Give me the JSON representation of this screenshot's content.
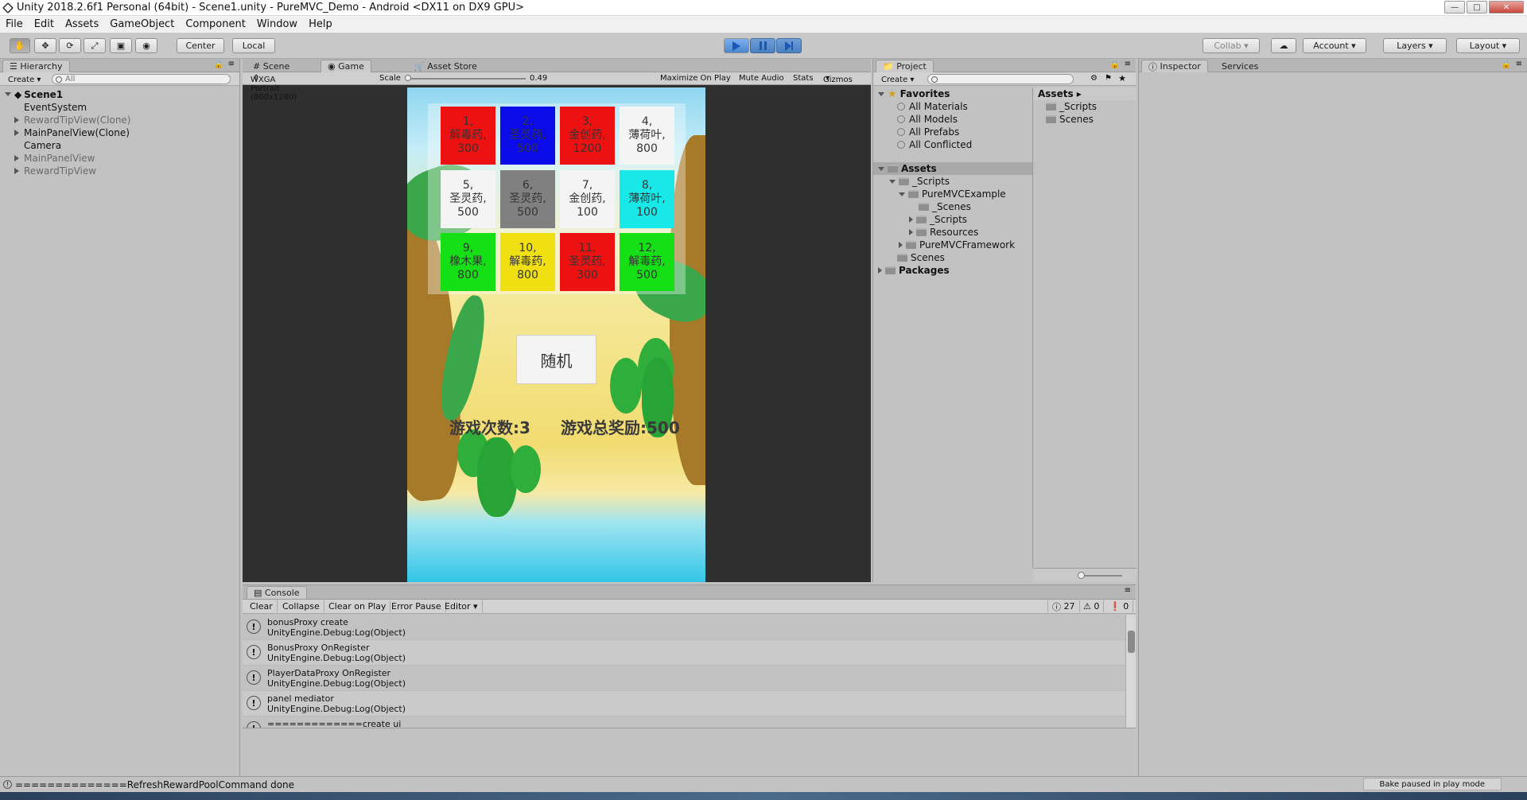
{
  "window": {
    "title": "Unity 2018.2.6f1 Personal (64bit) - Scene1.unity - PureMVC_Demo - Android <DX11 on DX9 GPU>"
  },
  "menu": [
    "File",
    "Edit",
    "Assets",
    "GameObject",
    "Component",
    "Window",
    "Help"
  ],
  "toolbar": {
    "pivot": "Center",
    "space": "Local",
    "collab": "Collab",
    "account": "Account",
    "layers": "Layers",
    "layout": "Layout"
  },
  "hierarchy": {
    "tab": "Hierarchy",
    "create": "Create",
    "search_placeholder": "All",
    "scene": "Scene1",
    "items": [
      {
        "label": "EventSystem",
        "prefab": false,
        "foldable": false
      },
      {
        "label": "RewardTipView(Clone)",
        "prefab": true,
        "foldable": true
      },
      {
        "label": "MainPanelView(Clone)",
        "prefab": false,
        "foldable": true
      },
      {
        "label": "Camera",
        "prefab": false,
        "foldable": false
      },
      {
        "label": "MainPanelView",
        "prefab": true,
        "foldable": true
      },
      {
        "label": "RewardTipView",
        "prefab": true,
        "foldable": true
      }
    ]
  },
  "gameview": {
    "tabs": [
      "Scene",
      "Game",
      "Asset Store"
    ],
    "resolution": "WXGA Portrait (800x1280)",
    "scale_label": "Scale",
    "scale_value": "0.49",
    "toggles": [
      "Maximize On Play",
      "Mute Audio",
      "Stats",
      "Gizmos"
    ]
  },
  "game": {
    "cells": [
      {
        "text": "1,\n解毒药,\n300",
        "color": "#ee1111"
      },
      {
        "text": "2,\n圣灵药,\n500",
        "color": "#0b0bea"
      },
      {
        "text": "3,\n金创药,\n1200",
        "color": "#ee1111"
      },
      {
        "text": "4,\n薄荷叶,\n800",
        "color": "#f4f4f4"
      },
      {
        "text": "5,\n圣灵药,\n500",
        "color": "#f4f4f4"
      },
      {
        "text": "6,\n圣灵药,\n500",
        "color": "#808080"
      },
      {
        "text": "7,\n金创药,\n100",
        "color": "#f4f4f4"
      },
      {
        "text": "8,\n薄荷叶,\n100",
        "color": "#18e8e8"
      },
      {
        "text": "9,\n橡木果,\n800",
        "color": "#15e015"
      },
      {
        "text": "10,\n解毒药,\n800",
        "color": "#f0e012"
      },
      {
        "text": "11,\n圣灵药,\n300",
        "color": "#ee1111"
      },
      {
        "text": "12,\n解毒药,\n500",
        "color": "#15e015"
      }
    ],
    "random_button": "随机",
    "play_count": "游戏次数:3",
    "total_reward": "游戏总奖励:500"
  },
  "project": {
    "tab": "Project",
    "create": "Create",
    "favorites": "Favorites",
    "fav_items": [
      "All Materials",
      "All Models",
      "All Prefabs",
      "All Conflicted"
    ],
    "assets": "Assets",
    "tree": [
      "_Scripts",
      "PureMVCExample",
      "_Scenes",
      "_Scripts",
      "Resources",
      "PureMVCFramework",
      "Scenes"
    ],
    "packages": "Packages",
    "right_header": "Assets",
    "right_items": [
      "_Scripts",
      "Scenes"
    ]
  },
  "inspector": {
    "tabs": [
      "Inspector",
      "Services"
    ]
  },
  "console": {
    "tab": "Console",
    "buttons": [
      "Clear",
      "Collapse",
      "Clear on Play",
      "Error Pause",
      "Editor"
    ],
    "counts": {
      "log": "27",
      "warn": "0",
      "error": "0"
    },
    "entries": [
      {
        "l1": "bonusProxy create",
        "l2": "UnityEngine.Debug:Log(Object)"
      },
      {
        "l1": "BonusProxy OnRegister",
        "l2": "UnityEngine.Debug:Log(Object)"
      },
      {
        "l1": "PlayerDataProxy OnRegister",
        "l2": "UnityEngine.Debug:Log(Object)"
      },
      {
        "l1": "panel mediator",
        "l2": "UnityEngine.Debug:Log(Object)"
      },
      {
        "l1": "=============create ui",
        "l2": ""
      }
    ]
  },
  "status": {
    "message": "==============RefreshRewardPoolCommand done",
    "right": "Bake paused in play mode"
  }
}
